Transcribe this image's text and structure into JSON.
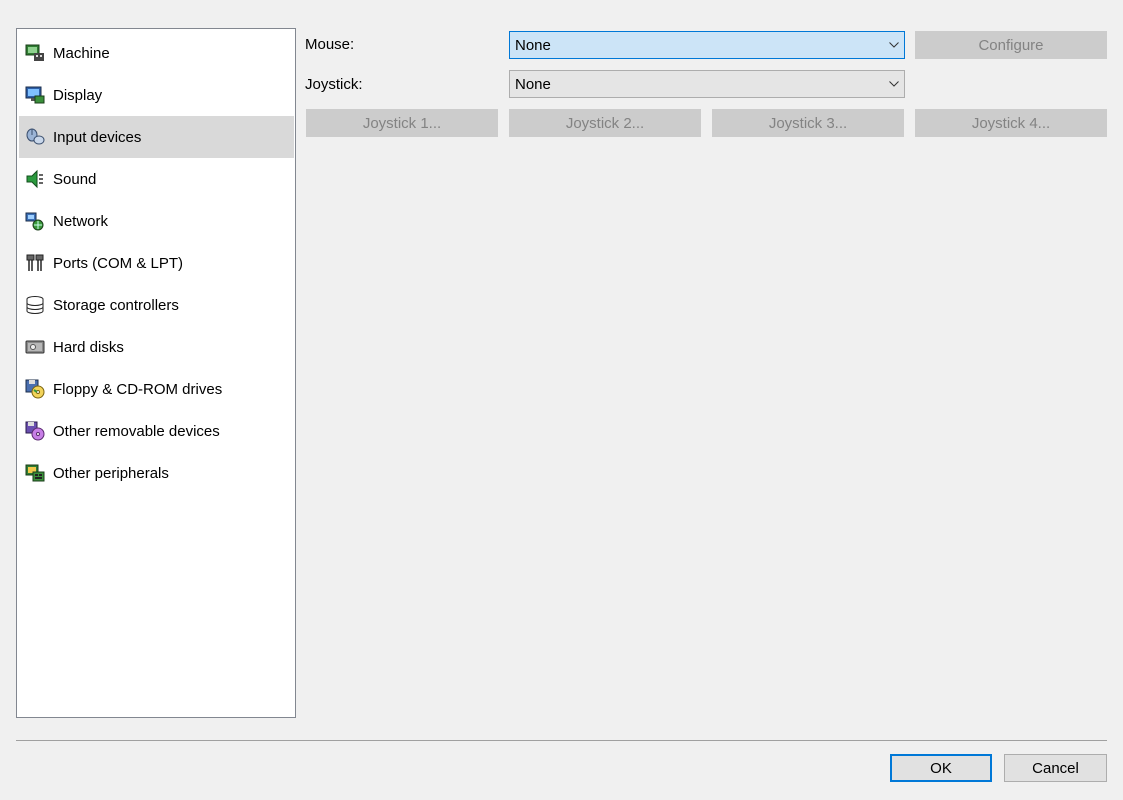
{
  "sidebar": {
    "items": [
      {
        "label": "Machine",
        "icon": "machine-icon"
      },
      {
        "label": "Display",
        "icon": "display-icon"
      },
      {
        "label": "Input devices",
        "icon": "input-devices-icon",
        "selected": true
      },
      {
        "label": "Sound",
        "icon": "sound-icon"
      },
      {
        "label": "Network",
        "icon": "network-icon"
      },
      {
        "label": "Ports (COM & LPT)",
        "icon": "ports-icon"
      },
      {
        "label": "Storage controllers",
        "icon": "storage-controllers-icon"
      },
      {
        "label": "Hard disks",
        "icon": "hard-disk-icon"
      },
      {
        "label": "Floppy & CD-ROM drives",
        "icon": "floppy-cdrom-icon"
      },
      {
        "label": "Other removable devices",
        "icon": "removable-devices-icon"
      },
      {
        "label": "Other peripherals",
        "icon": "peripherals-icon"
      }
    ]
  },
  "input": {
    "mouse_label": "Mouse:",
    "mouse_value": "None",
    "configure_label": "Configure",
    "joystick_label": "Joystick:",
    "joystick_value": "None",
    "joystick_buttons": [
      "Joystick 1...",
      "Joystick 2...",
      "Joystick 3...",
      "Joystick 4..."
    ]
  },
  "footer": {
    "ok_label": "OK",
    "cancel_label": "Cancel"
  },
  "colors": {
    "selection": "#d9d9d9",
    "focus_accent": "#0078d7",
    "focus_fill": "#cce4f7"
  }
}
